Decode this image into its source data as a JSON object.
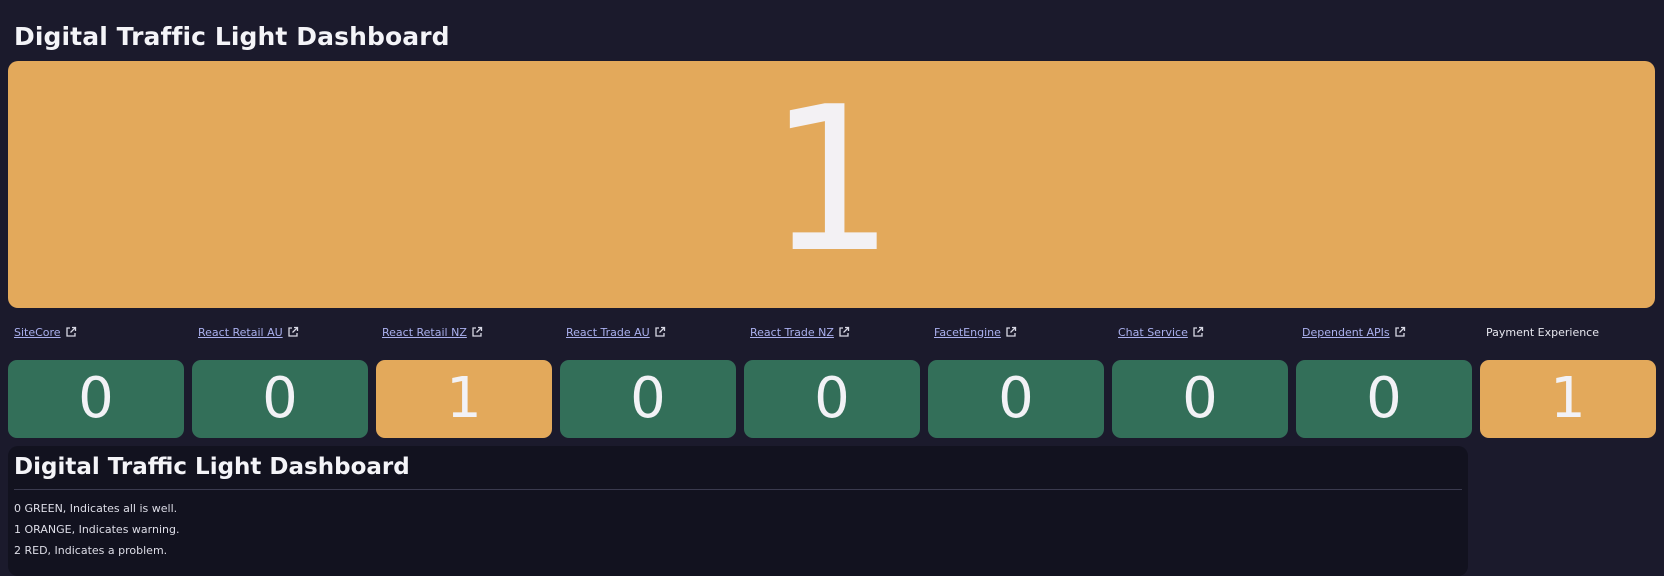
{
  "header": {
    "title": "Digital Traffic Light Dashboard"
  },
  "colors": {
    "green": "#336f59",
    "orange": "#e3a95b",
    "background": "#1b1a2c",
    "link": "#aab0ee"
  },
  "summary": {
    "value": "1",
    "status": "orange"
  },
  "services": [
    {
      "label": "SiteCore",
      "link": true,
      "value": "0",
      "status": "green"
    },
    {
      "label": "React Retail AU",
      "link": true,
      "value": "0",
      "status": "green"
    },
    {
      "label": "React Retail NZ",
      "link": true,
      "value": "1",
      "status": "orange"
    },
    {
      "label": "React Trade AU",
      "link": true,
      "value": "0",
      "status": "green"
    },
    {
      "label": "React Trade NZ",
      "link": true,
      "value": "0",
      "status": "green"
    },
    {
      "label": "FacetEngine",
      "link": true,
      "value": "0",
      "status": "green"
    },
    {
      "label": "Chat Service",
      "link": true,
      "value": "0",
      "status": "green"
    },
    {
      "label": "Dependent APIs",
      "link": true,
      "value": "0",
      "status": "green"
    },
    {
      "label": "Payment Experience",
      "link": false,
      "value": "1",
      "status": "orange"
    }
  ],
  "legend": {
    "title": "Digital Traffic Light Dashboard",
    "lines": [
      "0 GREEN, Indicates all is well.",
      "1 ORANGE, Indicates warning.",
      "2 RED, Indicates a problem."
    ]
  }
}
